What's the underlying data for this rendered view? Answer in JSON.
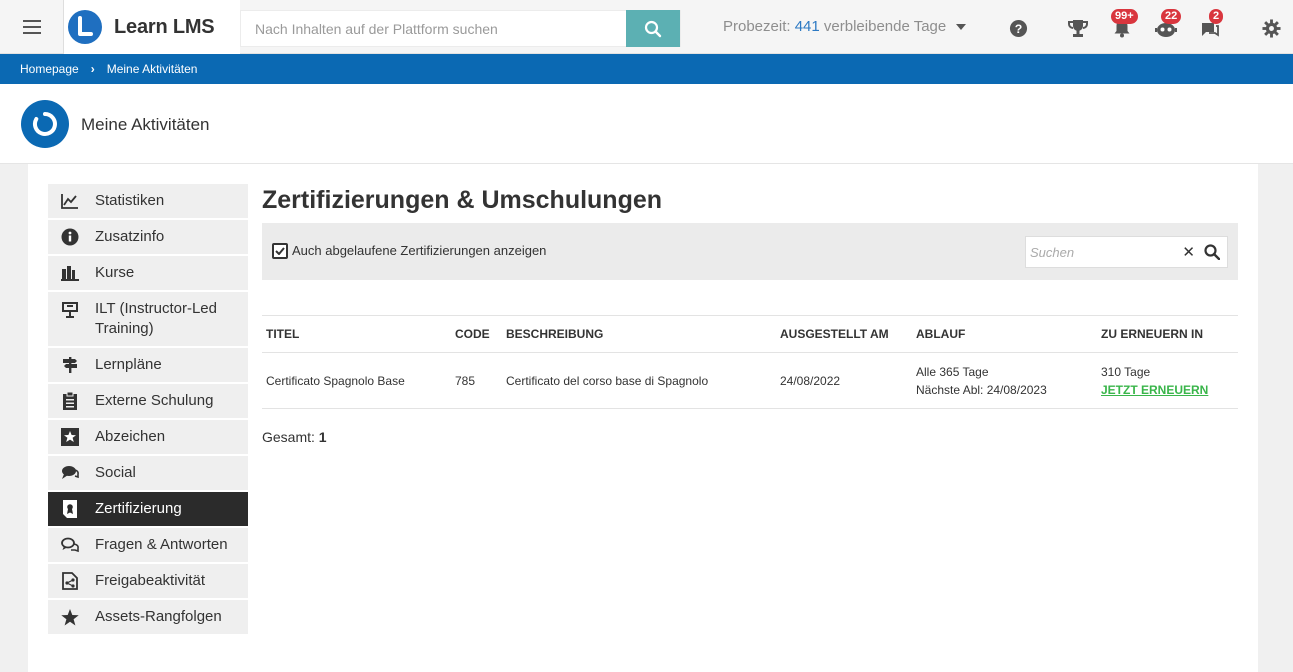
{
  "header": {
    "app_name": "Learn LMS",
    "search_placeholder": "Nach Inhalten auf der Plattform suchen",
    "trial_prefix": "Probezeit:",
    "trial_days": "441",
    "trial_suffix": "verbleibende Tage",
    "badges": {
      "notifications": "99+",
      "messages_bot": "22",
      "chat": "2"
    }
  },
  "breadcrumb": {
    "home": "Homepage",
    "current": "Meine Aktivitäten"
  },
  "page": {
    "title": "Meine Aktivitäten"
  },
  "sidebar": {
    "items": [
      {
        "label": "Statistiken",
        "icon": "chart-icon"
      },
      {
        "label": "Zusatzinfo",
        "icon": "info-icon"
      },
      {
        "label": "Kurse",
        "icon": "courses-icon"
      },
      {
        "label": "ILT (Instructor-Led Training)",
        "icon": "presentation-icon"
      },
      {
        "label": "Lernpläne",
        "icon": "signpost-icon"
      },
      {
        "label": "Externe Schulung",
        "icon": "clipboard-icon"
      },
      {
        "label": "Abzeichen",
        "icon": "badge-star-icon"
      },
      {
        "label": "Social",
        "icon": "chat-bubbles-icon"
      },
      {
        "label": "Zertifizierung",
        "icon": "certificate-icon",
        "active": true
      },
      {
        "label": "Fragen & Antworten",
        "icon": "qa-icon"
      },
      {
        "label": "Freigabeaktivität",
        "icon": "share-doc-icon"
      },
      {
        "label": "Assets-Rangfolgen",
        "icon": "star-icon"
      }
    ]
  },
  "content": {
    "title": "Zertifizierungen & Umschulungen",
    "checkbox_label": "Auch abgelaufene Zertifizierungen anzeigen",
    "search_placeholder": "Suchen",
    "columns": [
      "TITEL",
      "CODE",
      "BESCHREIBUNG",
      "AUSGESTELLT AM",
      "ABLAUF",
      "ZU ERNEUERN IN"
    ],
    "rows": [
      {
        "title": "Certificato Spagnolo Base",
        "code": "785",
        "description": "Certificato del corso base di Spagnolo",
        "issued": "24/08/2022",
        "expiry_line1": "Alle 365 Tage",
        "expiry_line2": "Nächste Abl: 24/08/2023",
        "renew_in": "310 Tage",
        "renew_link": "JETZT ERNEUERN"
      }
    ],
    "total_label": "Gesamt:",
    "total_value": "1"
  },
  "colors": {
    "primary": "#0b69b3",
    "search_button": "#5cb0b3",
    "badge": "#d9363e",
    "renew_link": "#39b54a",
    "active_item": "#2b2b2b"
  }
}
